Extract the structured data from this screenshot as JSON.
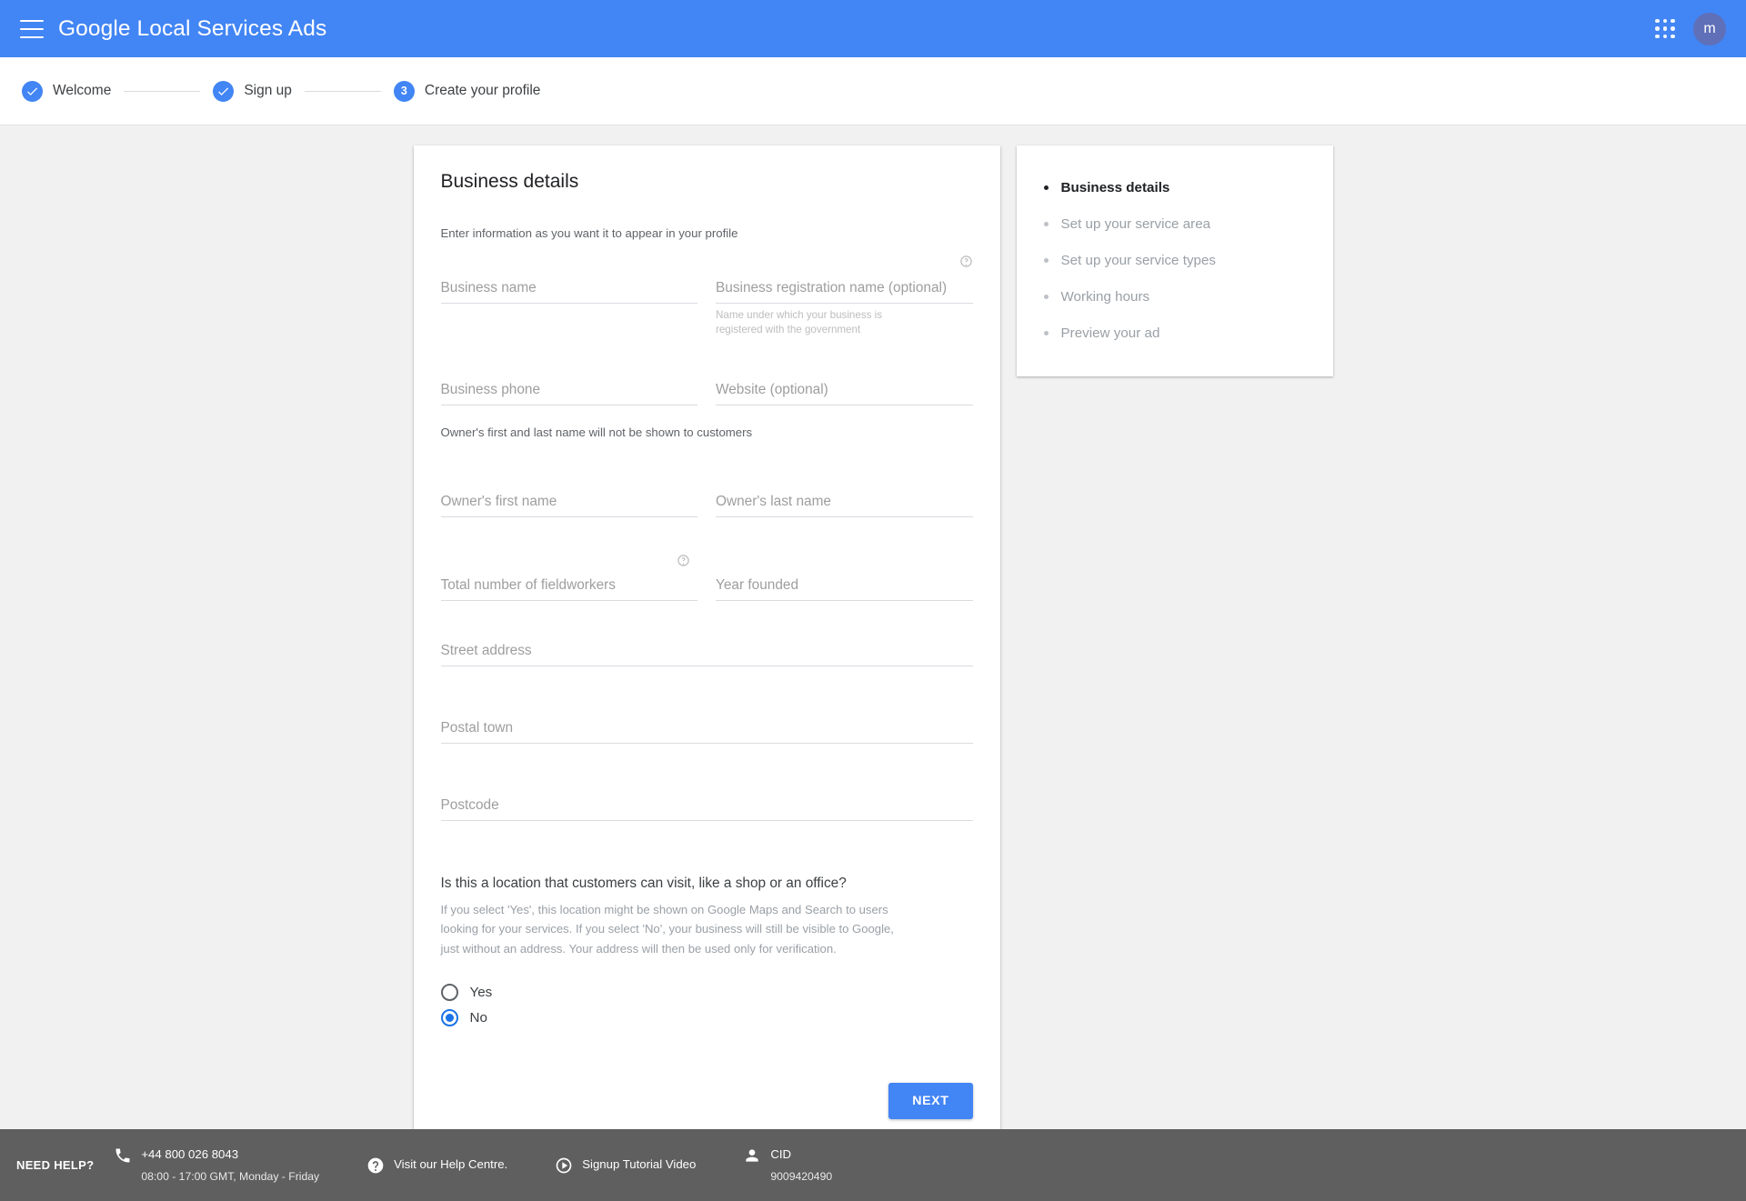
{
  "header": {
    "title": "Google Local Services Ads",
    "menu_icon": "hamburger-menu-icon",
    "apps_icon": "apps-grid-icon",
    "avatar_initial": "m",
    "background_color": "#4285f4"
  },
  "stepper": {
    "steps": [
      {
        "label": "Welcome",
        "state": "completed",
        "marker": "check"
      },
      {
        "label": "Sign up",
        "state": "completed",
        "marker": "check"
      },
      {
        "label": "Create your profile",
        "state": "active",
        "marker": "3"
      }
    ]
  },
  "form": {
    "title": "Business details",
    "subtitle": "Enter information as you want it to appear in your profile",
    "fields": {
      "business_name": {
        "placeholder": "Business name",
        "value": ""
      },
      "business_registration_name": {
        "placeholder": "Business registration name (optional)",
        "value": "",
        "help": "Name under which your business is registered with the government"
      },
      "business_phone": {
        "placeholder": "Business phone",
        "value": ""
      },
      "website": {
        "placeholder": "Website (optional)",
        "value": ""
      },
      "owner_first_name": {
        "placeholder": "Owner's first name",
        "value": ""
      },
      "owner_last_name": {
        "placeholder": "Owner's last name",
        "value": ""
      },
      "fieldworkers": {
        "placeholder": "Total number of fieldworkers",
        "value": ""
      },
      "year_founded": {
        "placeholder": "Year founded",
        "value": ""
      },
      "street_address": {
        "placeholder": "Street address",
        "value": ""
      },
      "postal_town": {
        "placeholder": "Postal town",
        "value": ""
      },
      "postcode": {
        "placeholder": "Postcode",
        "value": ""
      }
    },
    "owner_note": "Owner's first and last name will not be shown to customers",
    "question": {
      "title": "Is this a location that customers can visit, like a shop or an office?",
      "description": "If you select 'Yes', this location might be shown on Google Maps and Search to users looking for your services. If you select 'No', your business will still be visible to Google, just without an address. Your address will then be used only for verification.",
      "options": [
        {
          "label": "Yes",
          "selected": false
        },
        {
          "label": "No",
          "selected": true
        }
      ]
    },
    "next_button": "NEXT",
    "help_icon": "help-circle-icon"
  },
  "steps_panel": {
    "items": [
      {
        "label": "Business details",
        "active": true
      },
      {
        "label": "Set up your service area",
        "active": false
      },
      {
        "label": "Set up your service types",
        "active": false
      },
      {
        "label": "Working hours",
        "active": false
      },
      {
        "label": "Preview your ad",
        "active": false
      }
    ]
  },
  "footer": {
    "need_help": "NEED HELP?",
    "phone_icon": "phone-icon",
    "phone": "+44 800 026 8043",
    "hours": "08:00 - 17:00 GMT, Monday - Friday",
    "help_centre_icon": "help-circle-filled-icon",
    "help_centre": "Visit our Help Centre.",
    "video_icon": "play-circle-icon",
    "video": "Signup Tutorial Video",
    "cid_icon": "person-icon",
    "cid_label": "CID",
    "cid_value": "9009420490",
    "background_color": "#5f5f5f"
  }
}
